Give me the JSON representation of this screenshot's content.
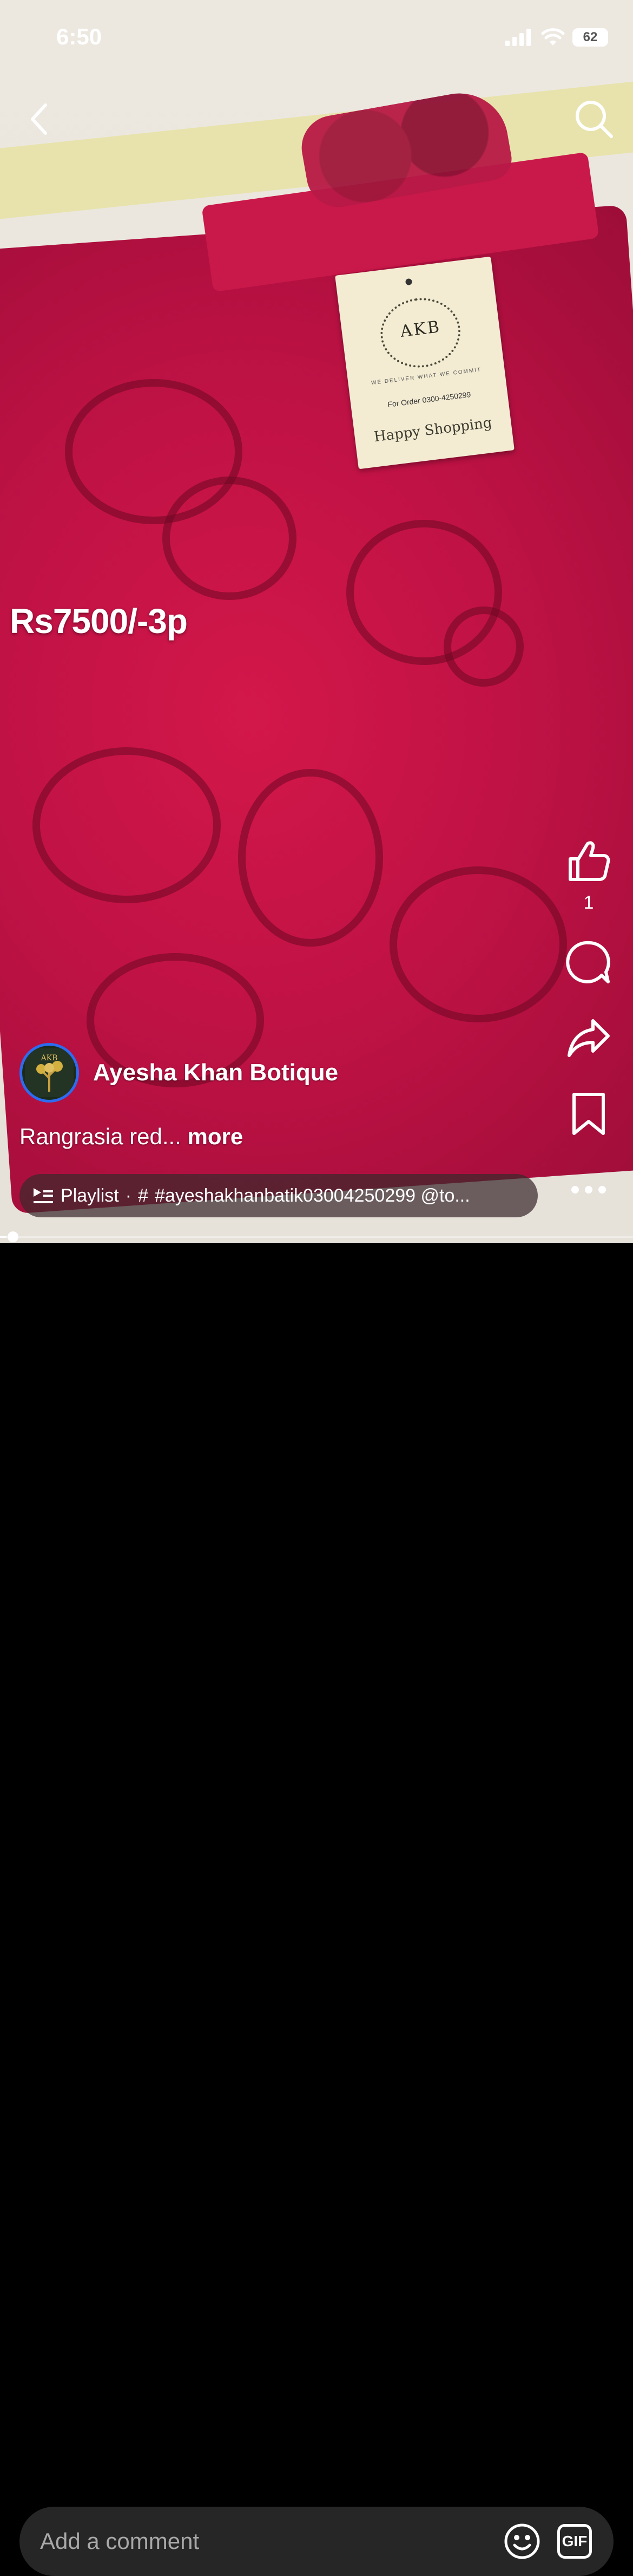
{
  "status_bar": {
    "time": "6:50",
    "battery": "62"
  },
  "overlay": {
    "price_text": "Rs7500/-3p"
  },
  "tag": {
    "brand": "AKB",
    "slogan": "WE DELIVER WHAT WE COMMIT",
    "order": "For Order 0300-4250299",
    "happy": "Happy Shopping"
  },
  "actions": {
    "like_count": "1"
  },
  "author": {
    "name": "Ayesha Khan Botique",
    "avatar_text": "AKB"
  },
  "caption": {
    "text": "Rangrasia red...",
    "more": "more"
  },
  "playlist": {
    "label": "Playlist",
    "separator": "·",
    "hash": "#",
    "tags": "#ayeshakhanbatik03004250299  @to..."
  },
  "progress": {
    "fraction": 0.01
  },
  "comment": {
    "placeholder": "Add a comment",
    "gif_label": "GIF"
  },
  "icons": [
    "back-icon",
    "search-icon",
    "like-icon",
    "comment-icon",
    "share-icon",
    "bookmark-icon",
    "more-icon",
    "playlist-icon",
    "emoji-icon",
    "gif-icon"
  ]
}
